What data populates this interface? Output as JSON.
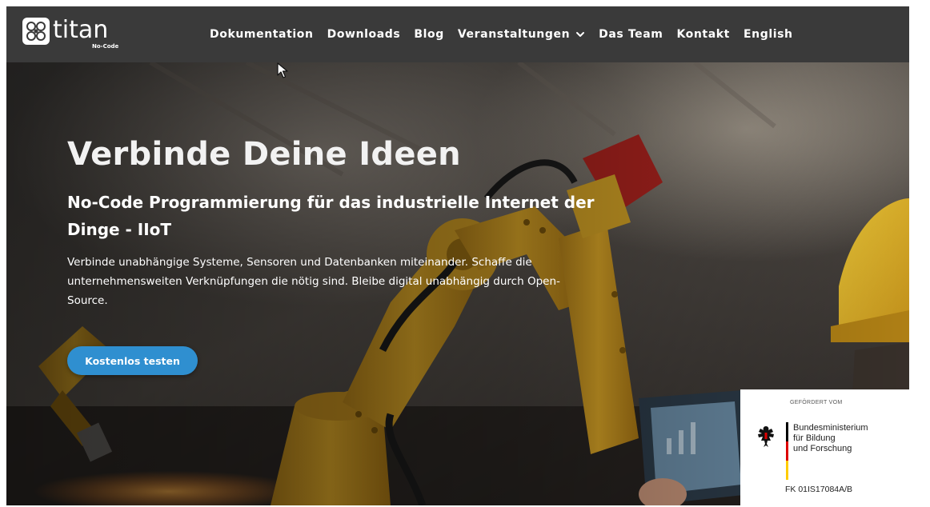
{
  "brand": {
    "name": "titan",
    "tagline": "No-Code"
  },
  "nav": {
    "items": [
      {
        "label": "Dokumentation"
      },
      {
        "label": "Downloads"
      },
      {
        "label": "Blog"
      },
      {
        "label": "Veranstaltungen",
        "has_dropdown": true
      },
      {
        "label": "Das Team"
      },
      {
        "label": "Kontakt"
      },
      {
        "label": "English"
      }
    ]
  },
  "hero": {
    "title": "Verbinde Deine Ideen",
    "subtitle": "No-Code Programmierung für das industrielle Internet der Dinge - IIoT",
    "text": "Verbinde unabhängige Systeme, Sensoren und Datenbanken miteinander. Schaffe die unternehmensweiten Verknüpfungen die nötig sind. Bleibe digital unabhängig durch Open-Source.",
    "cta_label": "Kostenlos testen"
  },
  "funding": {
    "header": "GEFÖRDERT VOM",
    "ministry_line1": "Bundesministerium",
    "ministry_line2": "für Bildung",
    "ministry_line3": "und Forschung",
    "code": "FK 01IS17084A/B"
  },
  "colors": {
    "navbar": "#3a3a3a",
    "cta": "#2f8fd0",
    "robot_yellow": "#d9a21b",
    "flag_black": "#000000",
    "flag_red": "#dd0000",
    "flag_gold": "#ffcc00"
  },
  "icons": {
    "logo": "titan-logo-mark",
    "dropdown": "chevron-down-icon",
    "cursor": "mouse-cursor-icon",
    "eagle": "federal-eagle-emblem"
  }
}
